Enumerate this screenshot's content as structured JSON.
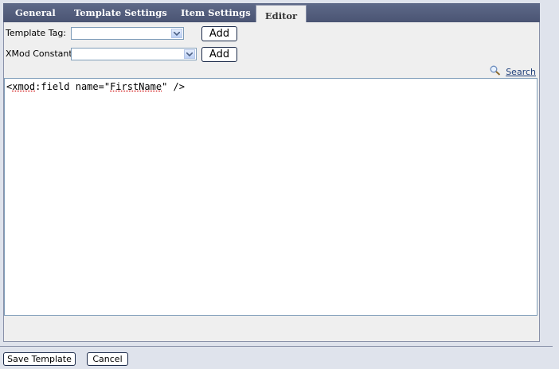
{
  "tabs": [
    {
      "label": "General",
      "active": false
    },
    {
      "label": "Template Settings",
      "active": false
    },
    {
      "label": "Item Settings",
      "active": false
    },
    {
      "label": "Editor",
      "active": true
    }
  ],
  "form": {
    "template_tag_label": "Template Tag:",
    "template_tag_value": "",
    "xmod_constant_label": "XMod Constant:",
    "xmod_constant_value": "",
    "add_label": "Add"
  },
  "search": {
    "label": "Search",
    "icon": "magnifier-icon"
  },
  "editor": {
    "code_prefix": "<",
    "code_tag": "xmod",
    "code_mid": ":field name=\"",
    "code_value": "FirstName",
    "code_suffix": "\" />"
  },
  "footer": {
    "save_label": "Save Template",
    "cancel_label": "Cancel"
  },
  "colors": {
    "tab_bar": "#55607f",
    "panel_bg": "#efefef",
    "page_bg": "#dfe3ec"
  }
}
